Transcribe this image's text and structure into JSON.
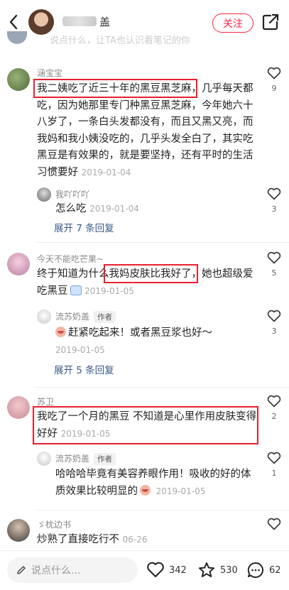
{
  "header": {
    "author_name_visible": "盖",
    "follow_label": "关注"
  },
  "prev_comment_text": "说点什么，让TA也认识看笔记的你",
  "comments": [
    {
      "user": "涵宝宝",
      "text_highlight": "我二姨吃了近三十年的黑豆黑芝麻，",
      "text_rest_line1": "几乎每天都",
      "text_rest": "吃，因为她那里专门种黑豆黑芝麻，今年她六十八岁了，一条白头发都没有，而且又黑又亮，而我妈和我小姨没吃的，几乎头发全白了，其实吃黑豆是有效果的，就是要坚持，还有平时的生活习惯要好",
      "date": "2019-01-04",
      "likes": "9",
      "reply": {
        "user": "我吖吖吖",
        "text": "怎么吃",
        "date": "2019-01-04",
        "likes": "3"
      },
      "expand_label": "展开 7 条回复"
    },
    {
      "user": "今天不能吃芒果~",
      "text_before": "终于知道为什么",
      "text_highlight": "我妈皮肤比我好了，",
      "text_after": "她也超级爱吃黑豆",
      "date": "2019-01-05",
      "likes": "5",
      "reply": {
        "user": "流苏奶盖",
        "author_tag": "作者",
        "text": "赶紧吃起来！或者黑豆浆也好～",
        "date": "2019-01-05",
        "likes": "3"
      },
      "expand_label": "展开 5 条回复"
    },
    {
      "user": "苏卫",
      "text_line1": "我吃了一个月的黑豆 不知道是心里作用皮肤变得",
      "text_line2": "好好",
      "date": "2019-01-05",
      "likes": "2",
      "reply": {
        "user": "流苏奶盖",
        "author_tag": "作者",
        "text_line1": "哈哈哈毕竟有美容养眼作用！吸收的好的体",
        "text_line2": "质效果比较明显的",
        "date": "2019-01-05",
        "likes": "1"
      }
    },
    {
      "user": "ゞ枕边书",
      "text": "炒熟了直接吃行不",
      "date": "06-26",
      "likes": ""
    }
  ],
  "bottom": {
    "input_placeholder": "说点什么...",
    "likes": "342",
    "stars": "530",
    "comments": "62"
  },
  "colors": {
    "accent": "#ff2442",
    "highlight_box": "#e8202f",
    "link": "#3b5a86"
  }
}
